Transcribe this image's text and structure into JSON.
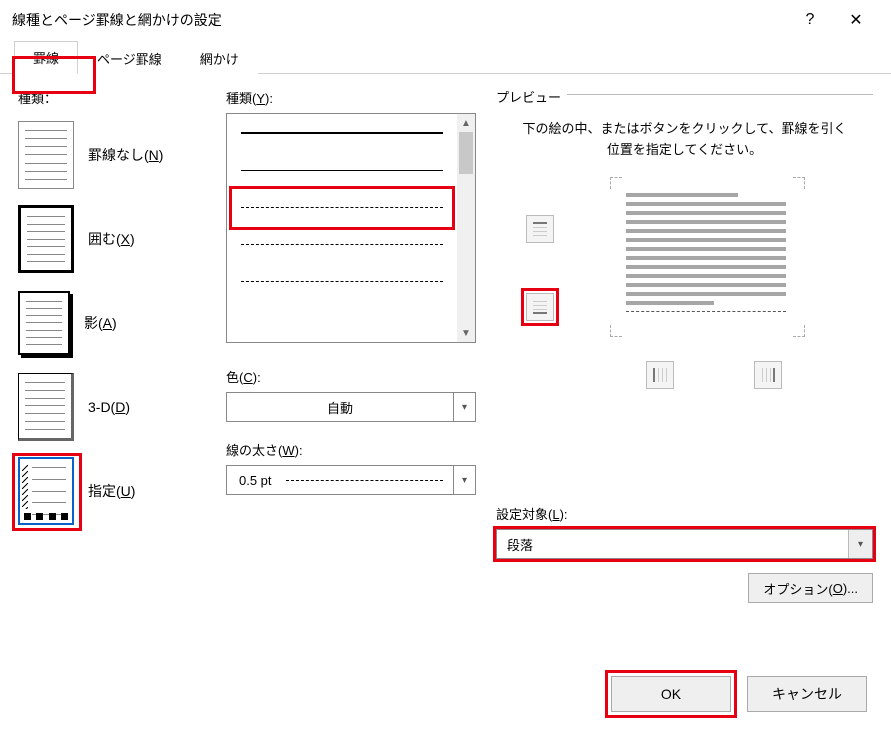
{
  "title": "線種とページ罫線と網かけの設定",
  "titlebar": {
    "help": "?",
    "close": "✕"
  },
  "tabs": {
    "borders": "罫線",
    "page_borders": "ページ罫線",
    "shading": "網かけ"
  },
  "left": {
    "heading": "種類：",
    "items": {
      "none": {
        "label": "罫線なし(",
        "key": "N",
        "tail": ")"
      },
      "box": {
        "label": "囲む(",
        "key": "X",
        "tail": ")"
      },
      "shadow": {
        "label": "影(",
        "key": "A",
        "tail": ")"
      },
      "threeD": {
        "label": "3-D(",
        "key": "D",
        "tail": ")"
      },
      "custom": {
        "label": "指定(",
        "key": "U",
        "tail": ")"
      }
    }
  },
  "mid": {
    "style_heading_pre": "種類(",
    "style_key": "Y",
    "style_heading_post": "):",
    "color_heading_pre": "色(",
    "color_key": "C",
    "color_heading_post": "):",
    "color_value": "自動",
    "width_heading_pre": "線の太さ(",
    "width_key": "W",
    "width_heading_post": "):",
    "width_value": "0.5 pt"
  },
  "right": {
    "preview_heading": "プレビュー",
    "help_text": "下の絵の中、またはボタンをクリックして、罫線を引く位置を指定してください。",
    "apply_heading_pre": "設定対象(",
    "apply_key": "L",
    "apply_heading_post": "):",
    "apply_value": "段落",
    "options_pre": "オプション(",
    "options_key": "O",
    "options_post": ")..."
  },
  "footer": {
    "ok": "OK",
    "cancel": "キャンセル"
  }
}
